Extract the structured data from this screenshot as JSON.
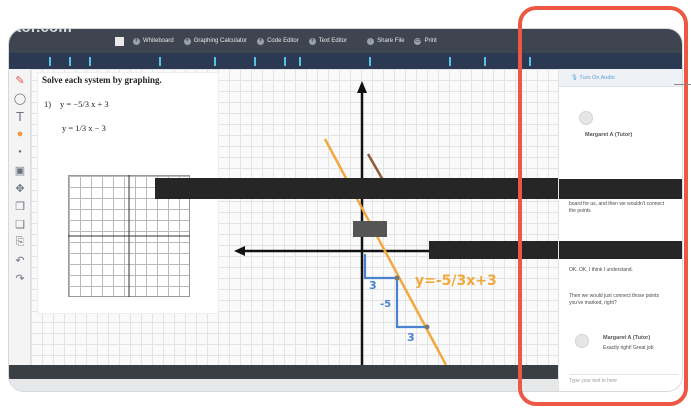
{
  "app": {
    "brand": "utor.com"
  },
  "toolbar": {
    "items": [
      {
        "label": "Whiteboard"
      },
      {
        "label": "Graphing Calculator"
      },
      {
        "label": "Code Editor"
      },
      {
        "label": "Text Editor"
      },
      {
        "label": "Share File"
      },
      {
        "label": "Print"
      }
    ]
  },
  "worksheet": {
    "title": "Solve each system by graphing.",
    "problem_number": "1)",
    "eq1": "y = −5/3 x + 3",
    "eq2": "y = 1/3 x − 3"
  },
  "annotations": {
    "line_label": "y=-5/3x+3",
    "rise_top": "3",
    "run": "-5",
    "rise_bottom": "3"
  },
  "chat": {
    "header": "Turn On Audio",
    "messages": [
      {
        "name": "Margaret A (Tutor)",
        "text": ""
      },
      {
        "name": "",
        "text": "board for us, and then we wouldn't connect the points"
      },
      {
        "name": "",
        "text": "OK. OK, I think I understand."
      },
      {
        "name": "",
        "text": "Then we would just connect those points you've marked, right?"
      },
      {
        "name": "Margaret A (Tutor)",
        "text": "Exactly right! Great job"
      }
    ],
    "input_placeholder": "Type your text in here"
  },
  "colors": {
    "toolbar": "#3f4550",
    "accent_orange": "#f3a83d",
    "accent_blue": "#4a82cf",
    "highlight": "#ec5843"
  }
}
